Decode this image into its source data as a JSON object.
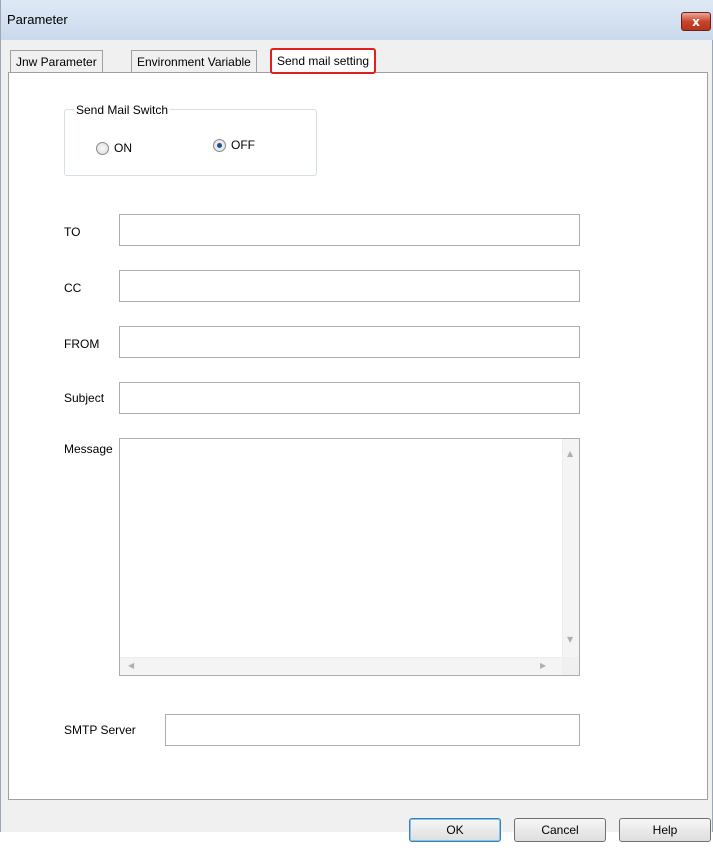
{
  "window": {
    "title": "Parameter",
    "close_label": "x"
  },
  "tabs": [
    {
      "label": "Jnw Parameter"
    },
    {
      "label": "Environment Variable"
    },
    {
      "label": "Send mail setting"
    }
  ],
  "send_mail_switch": {
    "legend": "Send Mail Switch",
    "options": [
      {
        "label": "ON",
        "checked": false
      },
      {
        "label": "OFF",
        "checked": true
      }
    ]
  },
  "fields": {
    "to": {
      "label": "TO",
      "value": ""
    },
    "cc": {
      "label": "CC",
      "value": ""
    },
    "from": {
      "label": "FROM",
      "value": ""
    },
    "subject": {
      "label": "Subject",
      "value": ""
    },
    "message": {
      "label": "Message",
      "value": ""
    },
    "smtp_server": {
      "label": "SMTP Server",
      "value": ""
    }
  },
  "buttons": {
    "ok": "OK",
    "cancel": "Cancel",
    "help": "Help"
  },
  "colors": {
    "highlight": "#e0201c",
    "radio_dot": "#1f4f9c"
  }
}
